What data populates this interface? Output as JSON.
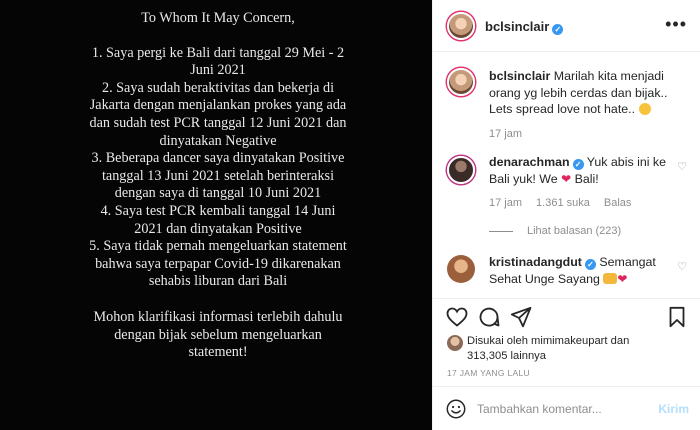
{
  "post": {
    "heading": "To Whom It May Concern,",
    "items": [
      "1. Saya pergi ke Bali dari tanggal 29 Mei - 2 Juni 2021",
      "2. Saya sudah beraktivitas dan bekerja di Jakarta dengan menjalankan prokes yang ada dan sudah test PCR tanggal 12 Juni 2021 dan dinyatakan Negative",
      "3. Beberapa dancer saya dinyatakan Positive tanggal 13 Juni 2021 setelah berinteraksi dengan saya di tanggal 10 Juni 2021",
      "4. Saya test PCR kembali tanggal 14 Juni 2021 dan dinyatakan Positive",
      "5. Saya tidak pernah mengeluarkan statement bahwa saya terpapar Covid-19 dikarenakan sehabis liburan dari Bali"
    ],
    "closing": "Mohon klarifikasi informasi terlebih dahulu dengan bijak sebelum mengeluarkan statement!"
  },
  "header": {
    "username": "bclsinclair",
    "verified_mark": "✓",
    "more": "•••"
  },
  "caption": {
    "username": "bclsinclair",
    "text": "Marilah kita menjadi orang yg lebih cerdas dan bijak.. Lets spread love not hate..",
    "time": "17 jam"
  },
  "comments": [
    {
      "username": "denarachman",
      "text_before": "Yuk abis ini ke Bali yuk! We",
      "text_after": "Bali!",
      "time": "17 jam",
      "likes": "1.361 suka",
      "reply": "Balas",
      "view_replies": "Lihat balasan (223)"
    },
    {
      "username": "kristinadangdut",
      "text": "Semangat Sehat Unge Sayang"
    }
  ],
  "likes": {
    "line1": "Disukai oleh mimimakeupart dan",
    "line2": "313,305 lainnya"
  },
  "time_ago": "17 JAM YANG LALU",
  "add_comment": {
    "placeholder": "Tambahkan komentar...",
    "post_label": "Kirim"
  },
  "colors": {
    "verified": "#3897f0",
    "heart": "#e0245e",
    "post_button": "#b2dffc",
    "secondary_text": "#8e8e8e"
  }
}
